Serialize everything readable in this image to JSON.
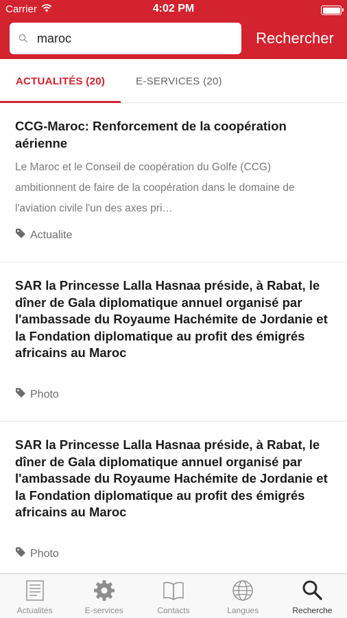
{
  "status_bar": {
    "carrier": "Carrier",
    "time": "4:02 PM"
  },
  "search": {
    "value": "maroc",
    "button_label": "Rechercher"
  },
  "tabs": [
    {
      "label": "ACTUALITÉS (20)",
      "active": true
    },
    {
      "label": "E-SERVICES (20)",
      "active": false
    }
  ],
  "articles": [
    {
      "title": "CCG-Maroc: Renforcement de la coopération aérienne",
      "excerpt": "Le Maroc et le Conseil de coopération du Golfe (CCG) ambitionnent de faire de la coopération dans le domaine de l'aviation civile l'un des axes pri…",
      "tag": "Actualite"
    },
    {
      "title": "SAR la Princesse Lalla Hasnaa préside, à Rabat, le dîner de Gala diplomatique annuel organisé par l'ambassade du Royaume Hachémite de Jordanie et la Fondation diplomatique au profit des émigrés africains au Maroc",
      "tag": "Photo"
    },
    {
      "title": "SAR la Princesse Lalla Hasnaa préside, à Rabat, le dîner de Gala diplomatique annuel organisé par l'ambassade du Royaume Hachémite de Jordanie et la Fondation diplomatique au profit des émigrés africains au Maroc",
      "tag": "Photo"
    }
  ],
  "tabbar": [
    {
      "label": "Actualités",
      "icon": "newspaper-icon"
    },
    {
      "label": "E-services",
      "icon": "gear-icon"
    },
    {
      "label": "Contacts",
      "icon": "book-icon"
    },
    {
      "label": "Langues",
      "icon": "globe-icon"
    },
    {
      "label": "Recherche",
      "icon": "search-icon",
      "active": true
    }
  ],
  "colors": {
    "accent": "#d2232e",
    "tab_inactive": "#8e8e8e"
  }
}
